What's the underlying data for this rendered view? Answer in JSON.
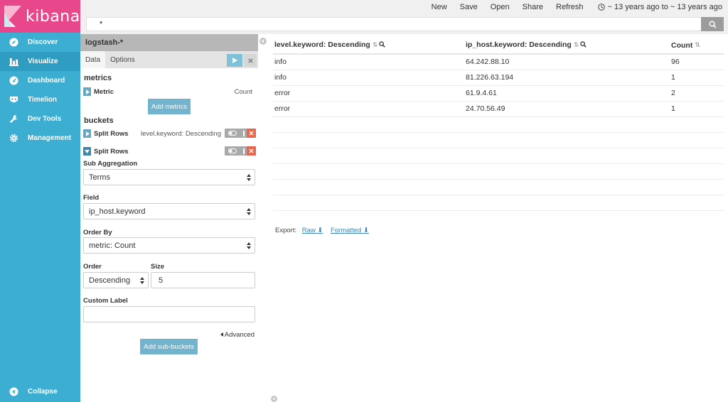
{
  "brand": {
    "name": "kibana"
  },
  "nav": {
    "items": [
      {
        "label": "Discover"
      },
      {
        "label": "Visualize"
      },
      {
        "label": "Dashboard"
      },
      {
        "label": "Timelion"
      },
      {
        "label": "Dev Tools"
      },
      {
        "label": "Management"
      }
    ],
    "collapse_label": "Collapse"
  },
  "topbar": {
    "new": "New",
    "save": "Save",
    "open": "Open",
    "share": "Share",
    "refresh": "Refresh",
    "time_range": "~ 13 years ago to ~ 13 years ago"
  },
  "query": {
    "value": "*"
  },
  "editor": {
    "index_pattern": "logstash-*",
    "tabs": [
      "Data",
      "Options"
    ],
    "metrics_title": "metrics",
    "metric": {
      "label": "Metric",
      "desc": "Count"
    },
    "add_metrics": "Add metrics",
    "buckets_title": "buckets",
    "bucket1": {
      "label": "Split Rows",
      "desc": "level.keyword: Descending"
    },
    "bucket2": {
      "label": "Split Rows"
    },
    "sub_agg": {
      "label": "Sub Aggregation",
      "value": "Terms"
    },
    "field": {
      "label": "Field",
      "value": "ip_host.keyword"
    },
    "order_by": {
      "label": "Order By",
      "value": "metric: Count"
    },
    "order": {
      "label": "Order",
      "value": "Descending"
    },
    "size": {
      "label": "Size",
      "value": "5"
    },
    "custom_label": {
      "label": "Custom Label",
      "value": ""
    },
    "advanced": "Advanced",
    "add_sub_buckets": "Add sub-buckets"
  },
  "table": {
    "headers": [
      "level.keyword: Descending",
      "ip_host.keyword: Descending",
      "Count"
    ],
    "rows": [
      [
        "info",
        "64.242.88.10",
        "96"
      ],
      [
        "info",
        "81.226.63.194",
        "1"
      ],
      [
        "error",
        "61.9.4.61",
        "2"
      ],
      [
        "error",
        "24.70.56.49",
        "1"
      ]
    ],
    "empty_rows": 6
  },
  "export": {
    "label": "Export:",
    "raw": "Raw",
    "formatted": "Formatted"
  },
  "colors": {
    "sidebar": "#3caed2",
    "brand": "#e8488b",
    "accent": "#72b4cd",
    "danger": "#e7664c"
  }
}
